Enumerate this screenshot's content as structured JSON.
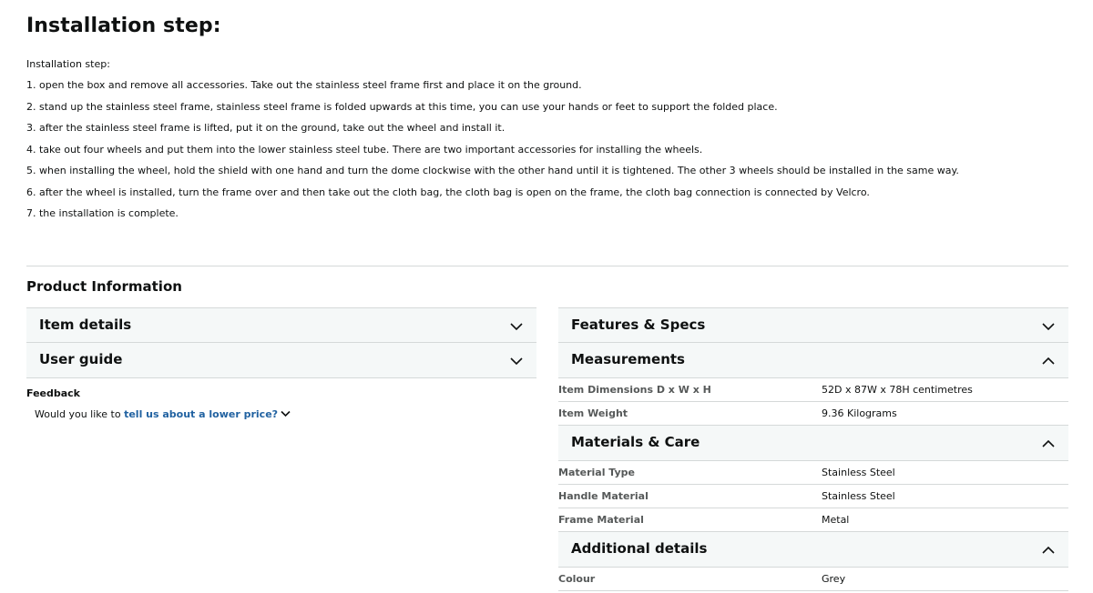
{
  "installation": {
    "title": "Installation step:",
    "subtitle": "Installation step:",
    "steps": [
      "1. open the box and remove all accessories. Take out the stainless steel frame first and place it on the ground.",
      "2. stand up the stainless steel frame, stainless steel frame is folded upwards at this time, you can use your hands or feet to support the folded place.",
      "3. after the stainless steel frame is lifted, put it on the ground, take out the wheel and install it.",
      "4. take out four wheels and put them into the lower stainless steel tube. There are two important accessories for installing the wheels.",
      "5. when installing the wheel, hold the shield with one hand and turn the dome clockwise with the other hand until it is tightened. The other 3 wheels should be installed in the same way.",
      "6. after the wheel is installed, turn the frame over and then take out the cloth bag, the cloth bag is open on the frame, the cloth bag connection is connected by Velcro.",
      "7. the installation is complete."
    ]
  },
  "product_info": {
    "heading": "Product Information",
    "left_sections": [
      {
        "title": "Item details",
        "expanded": false
      },
      {
        "title": "User guide",
        "expanded": false
      }
    ],
    "features_specs": {
      "title": "Features & Specs",
      "expanded": false
    },
    "measurements": {
      "title": "Measurements",
      "expanded": true,
      "rows": [
        {
          "label": "Item Dimensions D x W x H",
          "value": "52D x 87W x 78H centimetres"
        },
        {
          "label": "Item Weight",
          "value": "9.36 Kilograms"
        }
      ]
    },
    "materials_care": {
      "title": "Materials & Care",
      "expanded": true,
      "rows": [
        {
          "label": "Material Type",
          "value": "Stainless Steel"
        },
        {
          "label": "Handle Material",
          "value": "Stainless Steel"
        },
        {
          "label": "Frame Material",
          "value": "Metal"
        }
      ]
    },
    "additional_details": {
      "title": "Additional details",
      "expanded": true,
      "rows": [
        {
          "label": "Colour",
          "value": "Grey"
        }
      ]
    }
  },
  "feedback": {
    "label": "Feedback",
    "prefix": "Would you like to ",
    "link_text": "tell us about a lower price?"
  },
  "colors": {
    "link": "#2162a1",
    "accordion_bg": "#f5f8f8",
    "border": "#d5d9d9",
    "label_gray": "#565959"
  },
  "icons": [
    "chevron-down-icon",
    "chevron-up-icon"
  ]
}
